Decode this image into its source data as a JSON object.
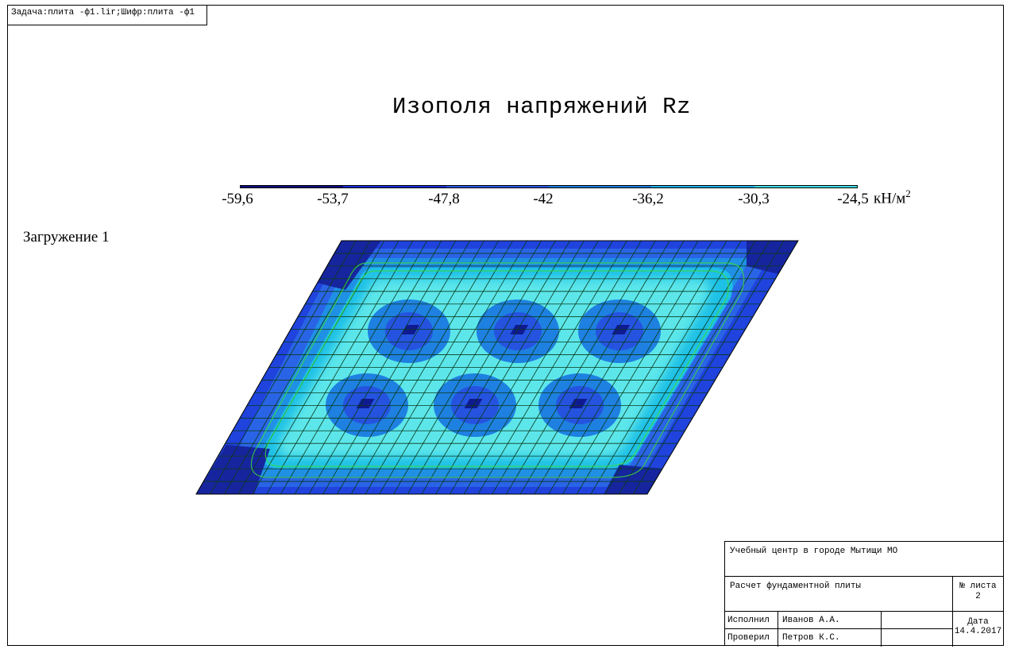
{
  "header": {
    "task_label": "Задача:плита -ф1.lir;Шифр:плита -ф1"
  },
  "plot": {
    "title": "Изополя напряжений Rz",
    "load_case": "Загружение 1"
  },
  "legend": {
    "unit": "кН/м",
    "unit_power": "2",
    "ticks": [
      "-59,6",
      "-53,7",
      "-47,8",
      "-42",
      "-36,2",
      "-30,3",
      "-24,5"
    ],
    "colors": [
      "#0a0a82",
      "#1a2fd8",
      "#2a5ae8",
      "#1e7de0",
      "#1fb2e6",
      "#3fe0e6"
    ]
  },
  "title_block": {
    "organization": "Учебный центр в городе Мытищи МО",
    "project": "Расчет фундаментной плиты",
    "sheet_label": "№ листа",
    "sheet_number": "2",
    "performed_label": "Исполнил",
    "performed_name": "Иванов А.А.",
    "checked_label": "Проверил",
    "checked_name": "Петров К.С.",
    "date_label": "Дата",
    "date_value": "14.4.2017"
  }
}
